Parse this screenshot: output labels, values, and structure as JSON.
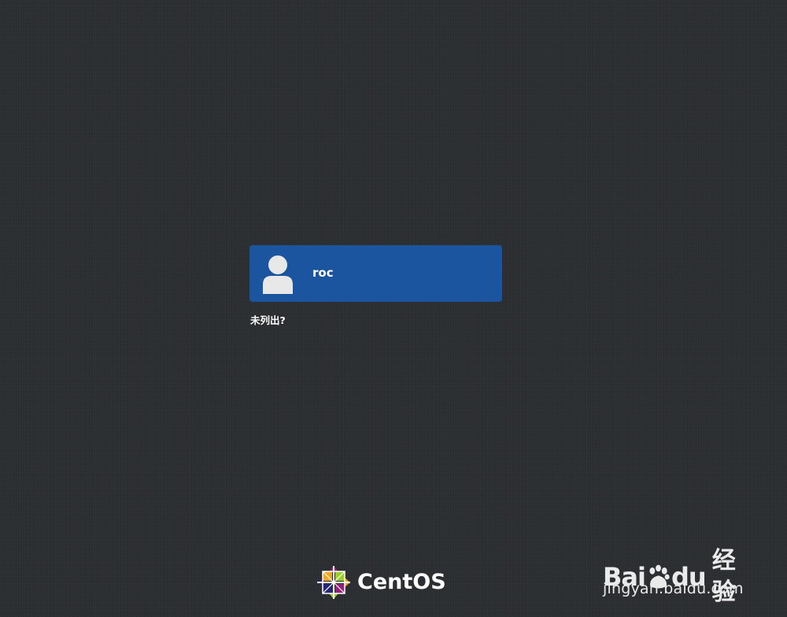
{
  "user_list": {
    "users": [
      {
        "name": "roc",
        "avatar_icon": "user-silhouette-icon"
      }
    ],
    "selected_color": "#1b55a0"
  },
  "not_listed_link": "未列出?",
  "branding": {
    "logo_icon": "centos-logo-icon",
    "logo_text": "CentOS"
  },
  "watermark": {
    "brand_prefix": "Bai",
    "paw_icon": "baidu-paw-icon",
    "brand_du": "du",
    "brand_suffix": "经验",
    "url": "jingyan.baidu.com"
  }
}
